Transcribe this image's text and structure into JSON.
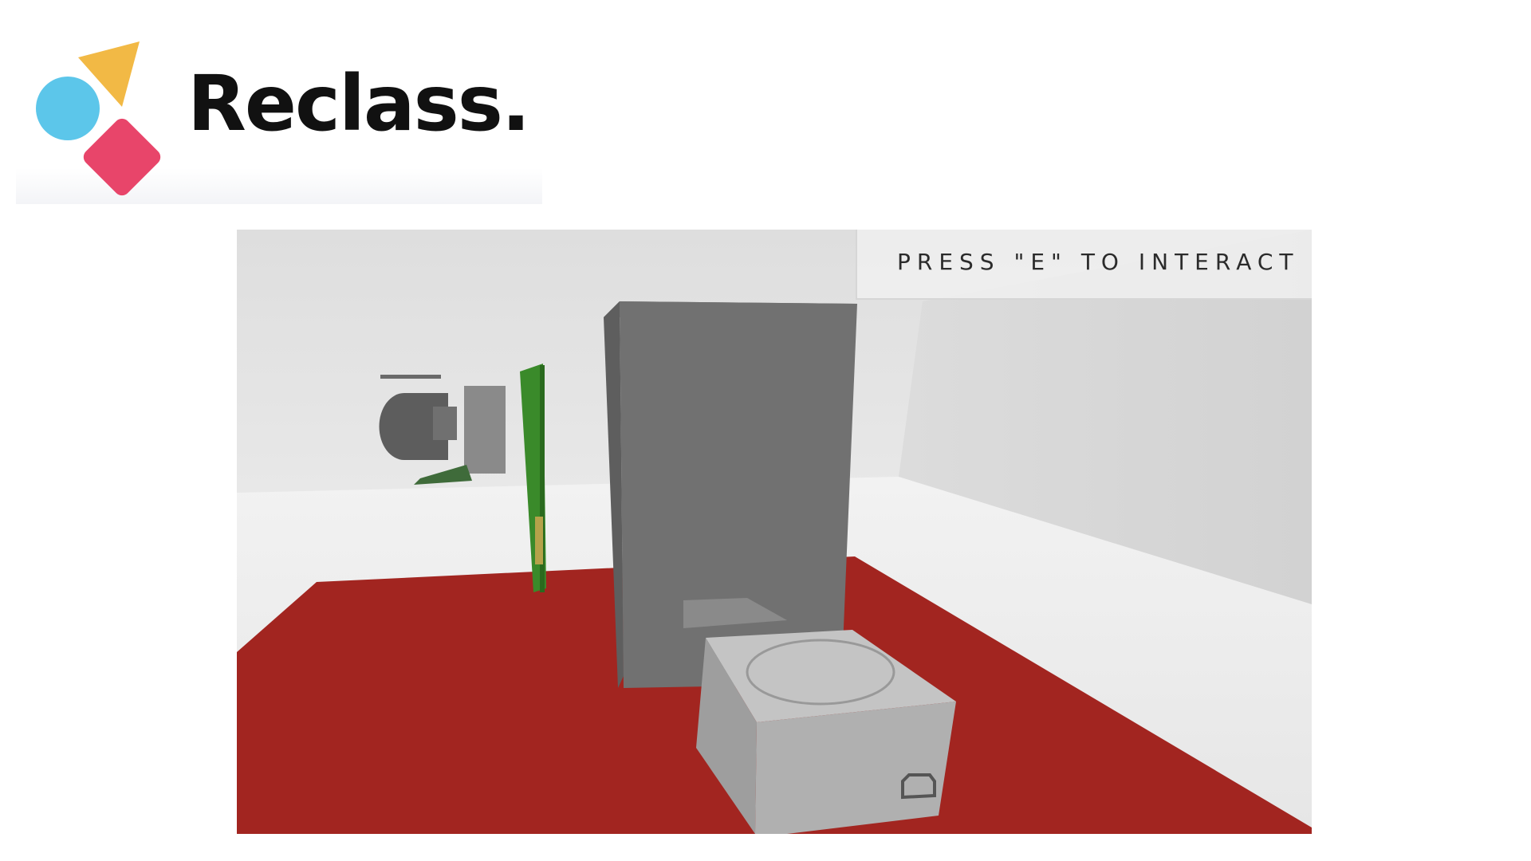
{
  "brand": {
    "name": "Reclass.",
    "colors": {
      "triangle": "#f2b945",
      "circle": "#5cc6ea",
      "diamond": "#e8456a"
    }
  },
  "game": {
    "prompt": "PRESS \"E\" TO INTERACT",
    "scene": {
      "wall_color": "#e2e2e2",
      "floor_color": "#f0f0f0",
      "mat_color": "#a22520",
      "tower_color": "#6f6f6f",
      "base_color": "#b2b2b2",
      "board_color": "#3a8a2a"
    }
  }
}
